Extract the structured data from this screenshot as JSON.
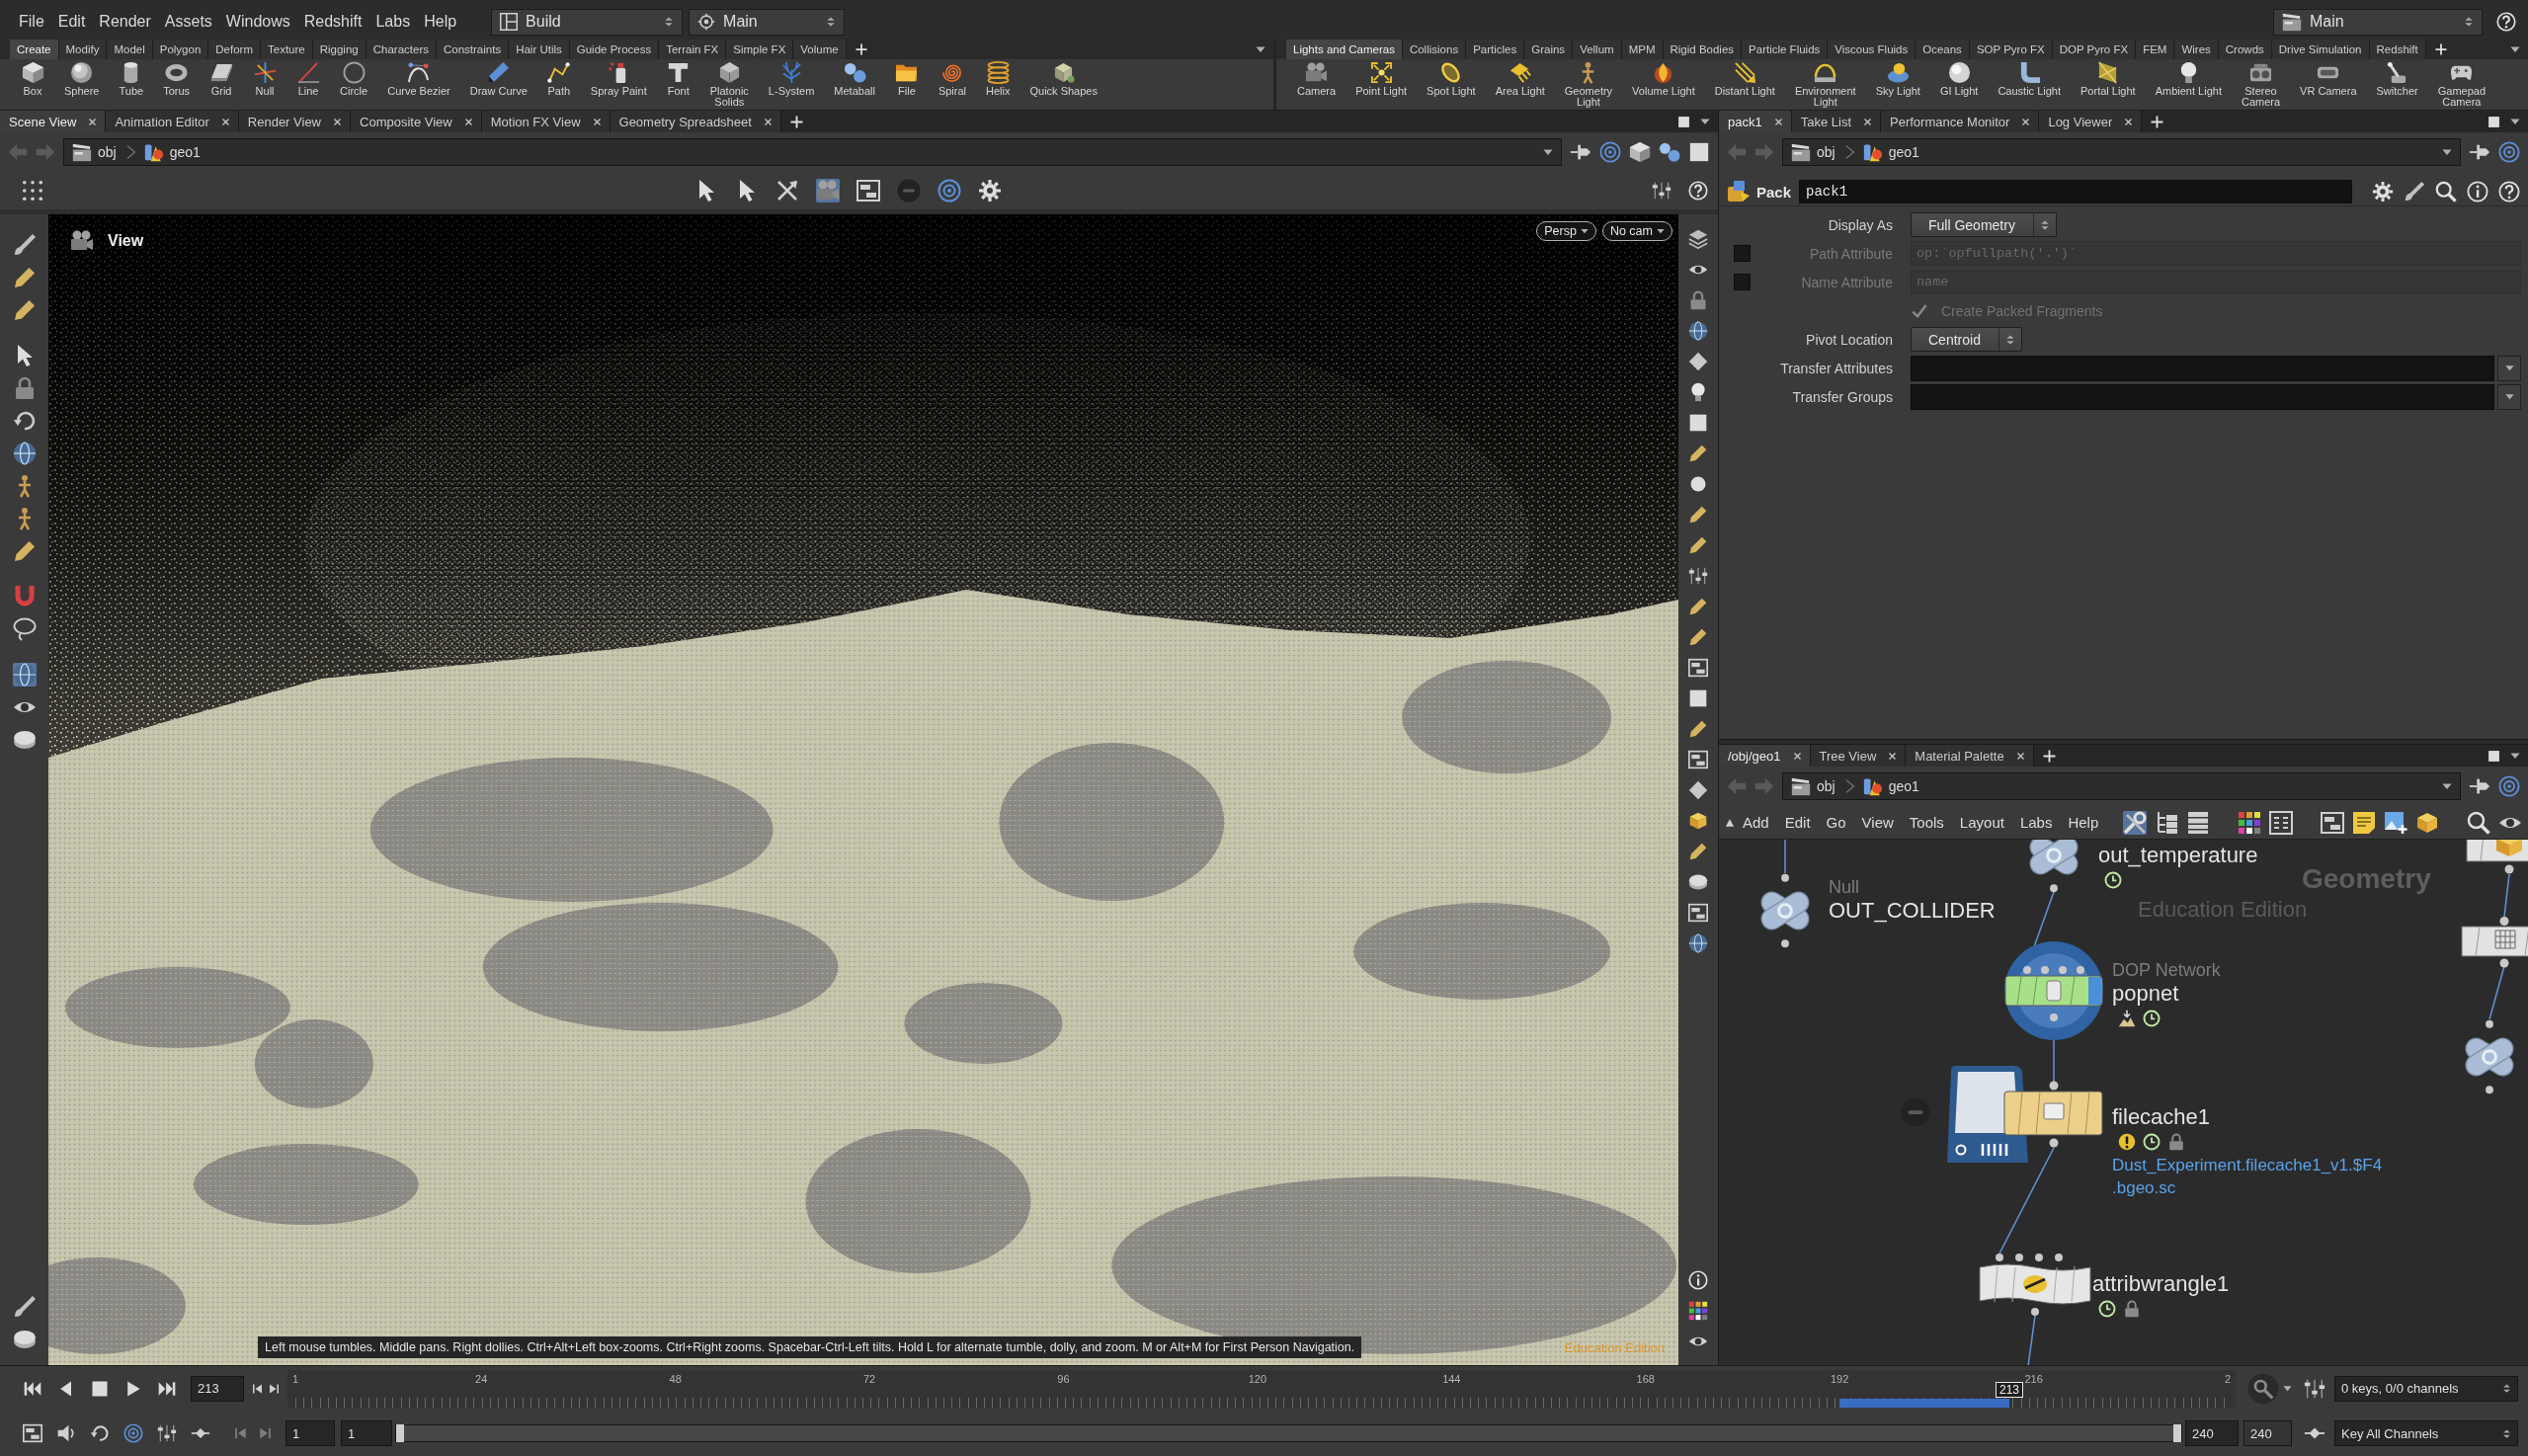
{
  "menubar": {
    "items": [
      "File",
      "Edit",
      "Render",
      "Assets",
      "Windows",
      "Redshift",
      "Labs",
      "Help"
    ],
    "dropdowns": [
      "Build",
      "Main"
    ],
    "right_dropdown": "Main"
  },
  "shelves": [
    {
      "tabs": [
        {
          "label": "Create",
          "selected": true
        },
        {
          "label": "Modify",
          "selected": false
        },
        {
          "label": "Model",
          "selected": false
        },
        {
          "label": "Polygon",
          "selected": false
        },
        {
          "label": "Deform",
          "selected": false
        },
        {
          "label": "Texture",
          "selected": false
        },
        {
          "label": "Rigging",
          "selected": false
        },
        {
          "label": "Characters",
          "selected": false
        },
        {
          "label": "Constraints",
          "selected": false
        },
        {
          "label": "Hair Utils",
          "selected": false
        },
        {
          "label": "Guide Process",
          "selected": false
        },
        {
          "label": "Terrain FX",
          "selected": false
        },
        {
          "label": "Simple FX",
          "selected": false
        },
        {
          "label": "Volume",
          "selected": false
        }
      ],
      "tools": [
        "Box",
        "Sphere",
        "Tube",
        "Torus",
        "Grid",
        "Null",
        "Line",
        "Circle",
        "Curve Bezier",
        "Draw Curve",
        "Path",
        "Spray Paint",
        "Font",
        "Platonic\nSolids",
        "L-System",
        "Metaball",
        "File",
        "Spiral",
        "Helix",
        "Quick Shapes"
      ]
    },
    {
      "tabs": [
        {
          "label": "Lights and Cameras",
          "selected": true
        },
        {
          "label": "Collisions",
          "selected": false
        },
        {
          "label": "Particles",
          "selected": false
        },
        {
          "label": "Grains",
          "selected": false
        },
        {
          "label": "Vellum",
          "selected": false
        },
        {
          "label": "MPM",
          "selected": false
        },
        {
          "label": "Rigid Bodies",
          "selected": false
        },
        {
          "label": "Particle Fluids",
          "selected": false
        },
        {
          "label": "Viscous Fluids",
          "selected": false
        },
        {
          "label": "Oceans",
          "selected": false
        },
        {
          "label": "SOP Pyro FX",
          "selected": false
        },
        {
          "label": "DOP Pyro FX",
          "selected": false
        },
        {
          "label": "FEM",
          "selected": false
        },
        {
          "label": "Wires",
          "selected": false
        },
        {
          "label": "Crowds",
          "selected": false
        },
        {
          "label": "Drive Simulation",
          "selected": false
        },
        {
          "label": "Redshift",
          "selected": false
        }
      ],
      "tools": [
        "Camera",
        "Point Light",
        "Spot Light",
        "Area Light",
        "Geometry\nLight",
        "Volume Light",
        "Distant Light",
        "Environment\nLight",
        "Sky Light",
        "GI Light",
        "Caustic Light",
        "Portal Light",
        "Ambient Light",
        "Stereo\nCamera",
        "VR Camera",
        "Switcher",
        "Gamepad\nCamera"
      ]
    }
  ],
  "scene_pane": {
    "tabs": [
      {
        "label": "Scene View",
        "selected": true
      },
      {
        "label": "Animation Editor",
        "selected": false
      },
      {
        "label": "Render View",
        "selected": false
      },
      {
        "label": "Composite View",
        "selected": false
      },
      {
        "label": "Motion FX View",
        "selected": false
      },
      {
        "label": "Geometry Spreadsheet",
        "selected": false
      }
    ],
    "path": [
      "obj",
      "geo1"
    ],
    "viewport": {
      "title": "View",
      "camera_menus": [
        "Persp",
        "No cam"
      ],
      "help": "Left mouse tumbles. Middle pans. Right dollies. Ctrl+Alt+Left box-zooms. Ctrl+Right zooms. Spacebar-Ctrl-Left tilts. Hold L for alternate tumble, dolly, and zoom. M or Alt+M for First Person Navigation.",
      "edition": "Education Edition"
    }
  },
  "parameter_pane": {
    "tabs": [
      {
        "label": "pack1",
        "selected": true
      },
      {
        "label": "Take List",
        "selected": false
      },
      {
        "label": "Performance Monitor",
        "selected": false
      },
      {
        "label": "Log Viewer",
        "selected": false
      }
    ],
    "path": [
      "obj",
      "geo1"
    ],
    "node": {
      "type": "Pack",
      "name": "pack1"
    },
    "parameters": [
      {
        "kind": "menu",
        "label": "Display As",
        "value": "Full Geometry",
        "disabled": false
      },
      {
        "kind": "toggle_text",
        "label": "Path Attribute",
        "value": "op:`opfullpath('.')`",
        "toggle_checked": false,
        "disabled": true
      },
      {
        "kind": "toggle_text",
        "label": "Name Attribute",
        "value": "name",
        "toggle_checked": false,
        "disabled": true
      },
      {
        "kind": "checkbox",
        "label": "Create Packed Fragments",
        "checked": true,
        "disabled": true
      },
      {
        "kind": "menu",
        "label": "Pivot Location",
        "value": "Centroid",
        "disabled": false
      },
      {
        "kind": "list",
        "label": "Transfer Attributes",
        "disabled": false
      },
      {
        "kind": "list",
        "label": "Transfer Groups",
        "disabled": false
      }
    ]
  },
  "network_pane": {
    "tabs": [
      {
        "label": "/obj/geo1",
        "selected": true
      },
      {
        "label": "Tree View",
        "selected": false
      },
      {
        "label": "Material Palette",
        "selected": false
      }
    ],
    "path": [
      "obj",
      "geo1"
    ],
    "menu": [
      "Add",
      "Edit",
      "Go",
      "View",
      "Tools",
      "Layout",
      "Labs",
      "Help"
    ],
    "context_label": "Geometry",
    "edition": "Education Edition",
    "nodes": [
      {
        "kind": "null",
        "type_label": "Null",
        "name": "OUT_COLLIDER"
      },
      {
        "kind": "null",
        "name": "out_temperature",
        "badges": [
          {
            "kind": "time_dependent"
          }
        ]
      },
      {
        "kind": "dop_network",
        "type_label": "DOP Network",
        "name": "popnet",
        "badges": [
          {
            "kind": "sim_cache"
          },
          {
            "kind": "time_dependent"
          }
        ]
      },
      {
        "kind": "file_cache",
        "name": "filecache1",
        "badges": [
          {
            "kind": "warning"
          },
          {
            "kind": "time_dependent"
          },
          {
            "kind": "lock"
          }
        ],
        "file_path": "Dust_Experiment.filecache1_v1.$F4\n.bgeo.sc"
      },
      {
        "kind": "wrangle",
        "name": "attribwrangle1",
        "badges": [
          {
            "kind": "time_dependent"
          },
          {
            "kind": "lock"
          }
        ]
      },
      {
        "kind": "pack"
      },
      {
        "kind": "grid"
      },
      {
        "kind": "null"
      }
    ]
  },
  "timeline": {
    "frame": "213",
    "ticks": [
      "1",
      "24",
      "48",
      "72",
      "96",
      "120",
      "144",
      "168",
      "192",
      "216",
      "2"
    ],
    "playhead": {
      "label": "213",
      "level": 0.887
    },
    "keys_info": "0 keys, 0/0 channels",
    "range": {
      "start": "1",
      "playback_start": "1",
      "playback_end": "240",
      "end": "240",
      "level": 1
    },
    "key_all": "Key All Channels"
  }
}
